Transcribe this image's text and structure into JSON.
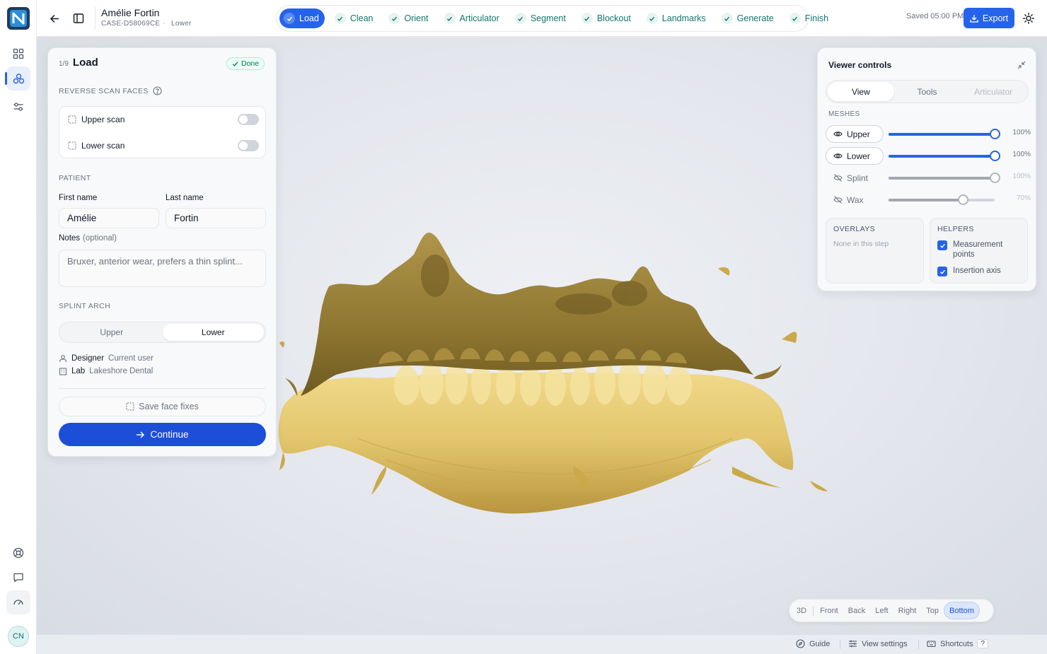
{
  "header": {
    "patient_name": "Amélie Fortin",
    "case_id": "CASE-D58069CE",
    "arch": "Lower",
    "saved_status": "Saved 05:00 PM",
    "export_label": "Export"
  },
  "steps": [
    {
      "label": "Load",
      "state": "active"
    },
    {
      "label": "Clean",
      "state": "done"
    },
    {
      "label": "Orient",
      "state": "done"
    },
    {
      "label": "Articulator",
      "state": "done"
    },
    {
      "label": "Segment",
      "state": "done"
    },
    {
      "label": "Blockout",
      "state": "done"
    },
    {
      "label": "Landmarks",
      "state": "done"
    },
    {
      "label": "Generate",
      "state": "done"
    },
    {
      "label": "Finish",
      "state": "done"
    }
  ],
  "panel": {
    "step_number": "1/9",
    "title": "Load",
    "status_badge": "Done",
    "reverse_section": "REVERSE SCAN FACES",
    "upper_scan_label": "Upper scan",
    "lower_scan_label": "Lower scan",
    "upper_scan_on": false,
    "lower_scan_on": false,
    "patient_section": "PATIENT",
    "first_name_label": "First name",
    "last_name_label": "Last name",
    "first_name_value": "Amélie",
    "last_name_value": "Fortin",
    "notes_label": "Notes",
    "notes_optional": "(optional)",
    "notes_placeholder": "Bruxer, anterior wear, prefers a thin splint...",
    "splint_arch_section": "SPLINT ARCH",
    "arch_options": [
      "Upper",
      "Lower"
    ],
    "arch_selected": "Lower",
    "designer_label": "Designer",
    "designer_value": "Current user",
    "lab_label": "Lab",
    "lab_value": "Lakeshore Dental",
    "save_fixes_label": "Save face fixes",
    "continue_label": "Continue"
  },
  "viewer_controls": {
    "title": "Viewer controls",
    "tabs": [
      "View",
      "Tools",
      "Articulator"
    ],
    "active_tab": "View",
    "meshes_section": "MESHES",
    "meshes": [
      {
        "name": "Upper",
        "visible": true,
        "opacity": "100%",
        "opacity_value": 1.0
      },
      {
        "name": "Lower",
        "visible": true,
        "opacity": "100%",
        "opacity_value": 1.0
      },
      {
        "name": "Splint",
        "visible": false,
        "opacity": "100%",
        "opacity_value": 1.0
      },
      {
        "name": "Wax",
        "visible": false,
        "opacity": "70%",
        "opacity_value": 0.7
      }
    ],
    "overlays_section": "OVERLAYS",
    "overlays_empty": "None in this step",
    "helpers_section": "HELPERS",
    "helpers": [
      {
        "label": "Measurement points",
        "checked": true
      },
      {
        "label": "Insertion axis",
        "checked": true
      }
    ]
  },
  "view_presets": {
    "options": [
      "3D",
      "Front",
      "Back",
      "Left",
      "Right",
      "Top",
      "Bottom"
    ],
    "selected": "Bottom"
  },
  "statusbar": {
    "guide_label": "Guide",
    "view_settings_label": "View settings",
    "shortcuts_label": "Shortcuts",
    "shortcuts_key": "?"
  },
  "user": {
    "initials": "CN"
  },
  "colors": {
    "accent": "#2563eb",
    "success": "#0f766e",
    "mesh": "#c9a94a"
  }
}
